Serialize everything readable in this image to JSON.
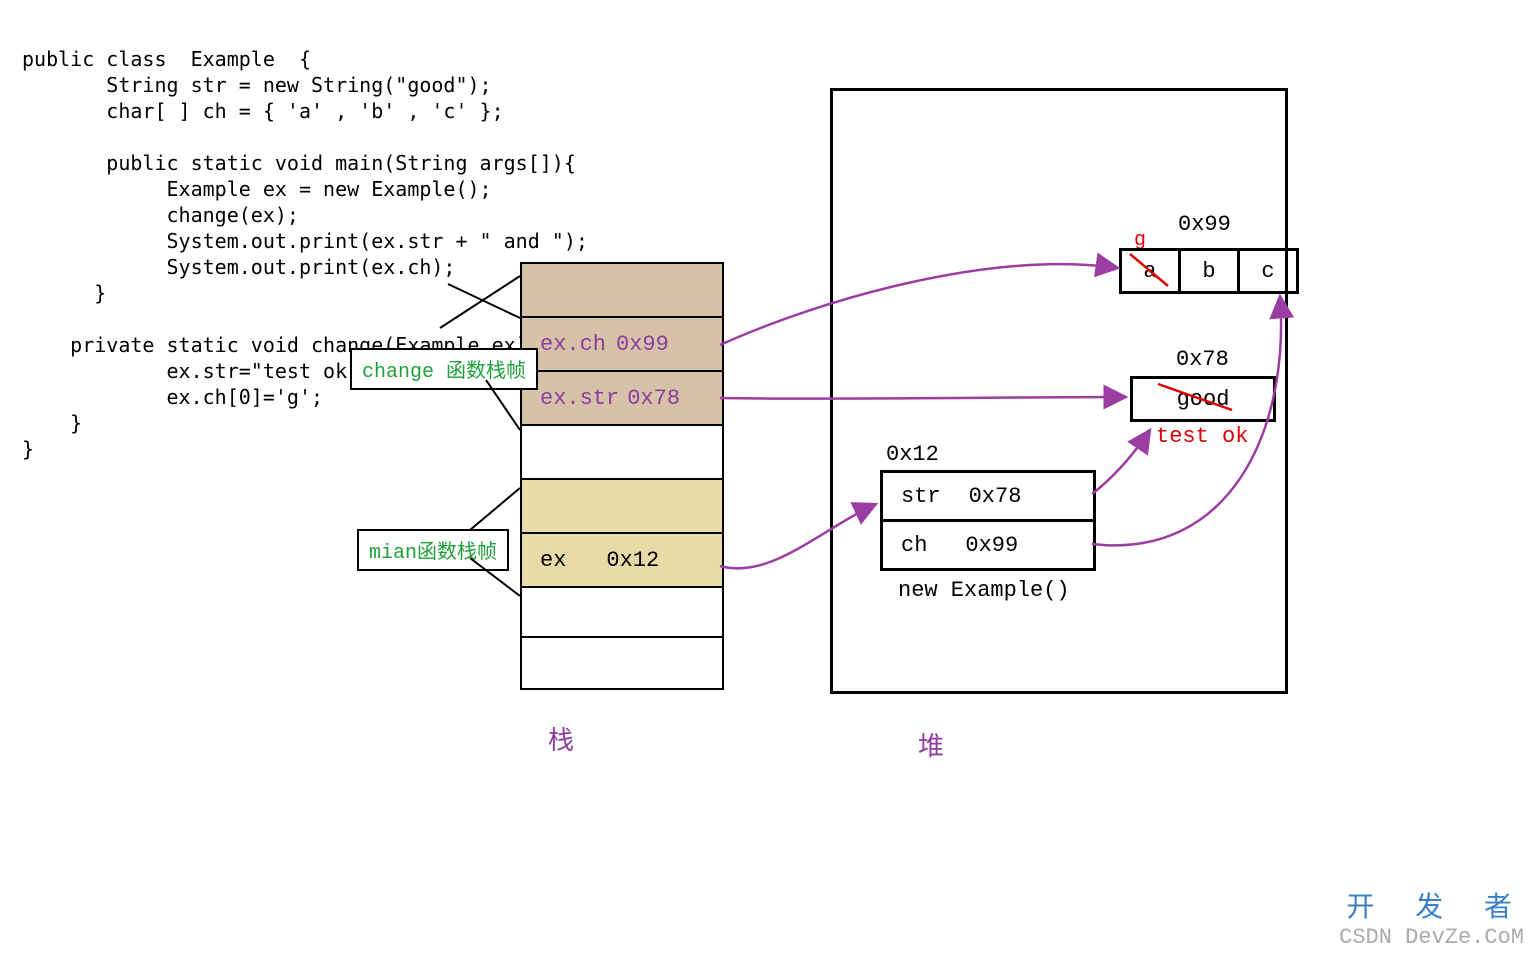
{
  "code": "public class  Example  {\n       String str = new String(\"good\");\n       char[ ] ch = { 'a' , 'b' , 'c' };\n\n       public static void main(String args[]){\n            Example ex = new Example();\n            change(ex);\n            System.out.print(ex.str + \" and \");\n            System.out.print(ex.ch);\n      }\n\n    private static void change(Example ex)  {\n            ex.str=\"test ok\";\n            ex.ch[0]='g';\n    }\n}",
  "labels": {
    "change_frame": "change 函数栈帧",
    "main_frame": "mian函数栈帧",
    "stack": "栈",
    "heap": "堆"
  },
  "stack": {
    "ex_ch": "ex.ch",
    "ex_ch_addr": "0x99",
    "ex_str": "ex.str",
    "ex_str_addr": "0x78",
    "ex": "ex",
    "ex_addr": "0x12"
  },
  "heap_items": {
    "array_addr": "0x99",
    "array_g": "g",
    "array_a": "a",
    "array_b": "b",
    "array_c": "c",
    "string_addr": "0x78",
    "string_good": "good",
    "string_test": "test ok",
    "obj_addr": "0x12",
    "obj_str": "str",
    "obj_str_val": "0x78",
    "obj_ch": "ch",
    "obj_ch_val": "0x99",
    "obj_label": "new Example()"
  },
  "watermark": {
    "line1": "开 发 者",
    "line2": "CSDN DevZe.CoM"
  },
  "chart_data": {
    "type": "diagram",
    "description": "Java stack and heap memory diagram showing object reference passing",
    "stack_frames": [
      {
        "frame": "change",
        "entries": [
          {
            "name": "ex.ch",
            "addr": "0x99"
          },
          {
            "name": "ex.str",
            "addr": "0x78"
          }
        ]
      },
      {
        "frame": "main",
        "entries": [
          {
            "name": "ex",
            "addr": "0x12"
          }
        ]
      }
    ],
    "heap_objects": [
      {
        "addr": "0x99",
        "type": "char[]",
        "value": [
          "a",
          "b",
          "c"
        ],
        "mutated": {
          "0": "g"
        }
      },
      {
        "addr": "0x78",
        "type": "String",
        "value": "good",
        "mutated": "test ok"
      },
      {
        "addr": "0x12",
        "type": "Example",
        "fields": {
          "str": "0x78",
          "ch": "0x99"
        }
      }
    ],
    "arrows": [
      {
        "from": "stack ex.ch 0x99",
        "to": "heap char[] 0x99"
      },
      {
        "from": "stack ex.str 0x78",
        "to": "heap String 0x78"
      },
      {
        "from": "stack ex 0x12",
        "to": "heap Example 0x12"
      },
      {
        "from": "Example.str 0x78",
        "to": "heap String 0x78"
      },
      {
        "from": "Example.ch 0x99",
        "to": "heap char[] 0x99"
      }
    ]
  }
}
